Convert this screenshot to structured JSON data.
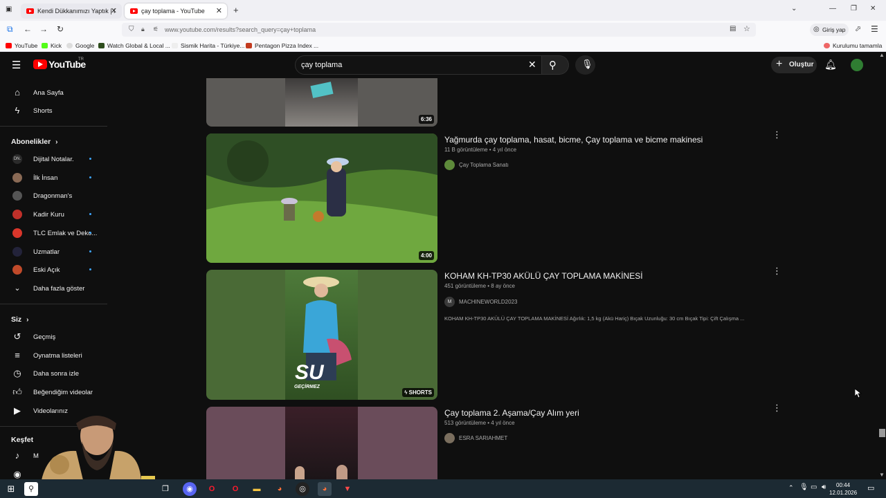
{
  "browser": {
    "tabs": [
      {
        "label": "Kendi Dükkanımızı Yaptık | Harı"
      },
      {
        "label": "çay toplama - YouTube"
      }
    ],
    "url": "www.youtube.com/results?search_query=çay+toplama",
    "signin": "Giriş yap",
    "bookmarks": [
      "YouTube",
      "Kick",
      "Google",
      "Watch Global & Local ...",
      "Sismik Harita - Türkiye...",
      "Pentagon Pizza Index ..."
    ],
    "bookmark_right": "Kurulumu tamamla"
  },
  "youtube": {
    "logo": "YouTube",
    "region": "TR",
    "search_value": "çay toplama",
    "create_label": "Oluştur"
  },
  "sidebar": {
    "main": [
      {
        "label": "Ana Sayfa",
        "icon": "home-icon"
      },
      {
        "label": "Shorts",
        "icon": "shorts-icon"
      }
    ],
    "subs_header": "Abonelikler",
    "subs": [
      {
        "label": "Dijital Notalar.",
        "dot": true,
        "color": "#2b2b2b"
      },
      {
        "label": "İlk İnsan",
        "dot": true,
        "color": "#8a6a55"
      },
      {
        "label": "Dragonman's",
        "dot": false,
        "color": "#555"
      },
      {
        "label": "Kadir Kuru",
        "dot": true,
        "color": "#c0302a"
      },
      {
        "label": "TLC Emlak ve Deko...",
        "dot": true,
        "color": "#d9362b"
      },
      {
        "label": "Uzmatlar",
        "dot": true,
        "color": "#23233a"
      },
      {
        "label": "Eski Açık",
        "dot": true,
        "color": "#c04a2a"
      }
    ],
    "more": "Daha fazla göster",
    "you_header": "Siz",
    "you": [
      {
        "label": "Geçmiş",
        "icon": "history-icon"
      },
      {
        "label": "Oynatma listeleri",
        "icon": "playlist-icon"
      },
      {
        "label": "Daha sonra izle",
        "icon": "clock-icon"
      },
      {
        "label": "Beğendiğim videolar",
        "icon": "like-icon"
      },
      {
        "label": "Videolarınız",
        "icon": "video-icon"
      }
    ],
    "explore_header": "Keşfet",
    "explore_first": "M"
  },
  "results": [
    {
      "duration": "6:36"
    },
    {
      "title": "Yağmurda çay toplama, hasat, bicme, Çay toplama ve bicme makinesi",
      "meta": "11 B görüntüleme • 4 yıl önce",
      "channel": "Çay Toplama Sanatı",
      "duration": "4:00"
    },
    {
      "title": "KOHAM KH-TP30 AKÜLÜ ÇAY TOPLAMA MAKİNESİ",
      "meta": "451 görüntüleme • 8 ay önce",
      "channel": "MACHINEWORLD2023",
      "avatar_letter": "M",
      "desc": "KOHAM KH-TP30 AKÜLÜ ÇAY TOPLAMA MAKİNESİ Ağırlık: 1,5 kg (Akü Hariç) Bıçak Uzunluğu: 30 cm Bıçak Tipi: Çift Çalışma ...",
      "badge": "SHORTS",
      "overlay": "SU",
      "overlay_sub": "GEÇİRMEZ"
    },
    {
      "title": "Çay toplama 2. Aşama/Çay Alım yeri",
      "meta": "513 görüntüleme • 4 yıl önce",
      "channel": "ESRA SARIAHMET"
    }
  ],
  "taskbar": {
    "time": "00:44",
    "date": "12.01.2026"
  }
}
